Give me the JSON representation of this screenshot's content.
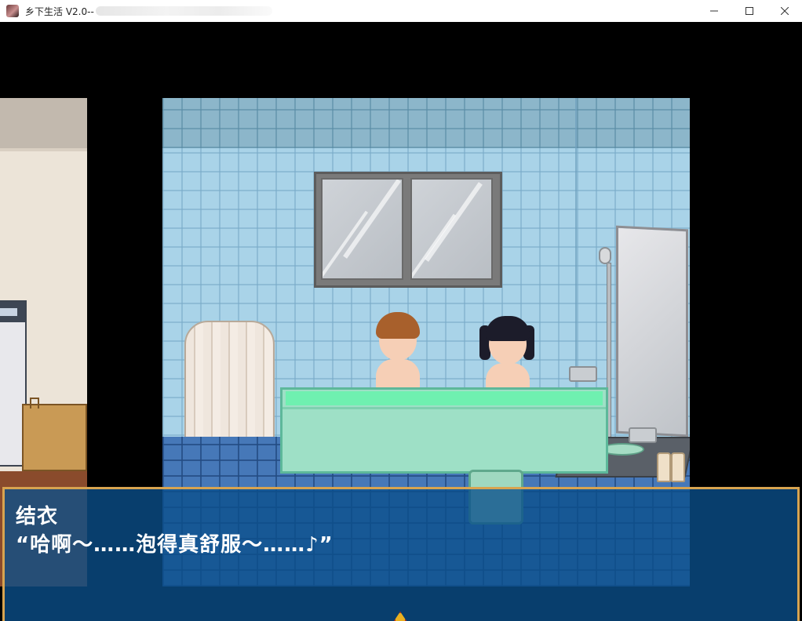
{
  "window": {
    "title": "乡下生活 V2.0--",
    "controls": [
      "minimize-icon",
      "maximize-icon",
      "close-icon"
    ]
  },
  "dialogue": {
    "speaker": "结衣",
    "text": "“哈啊～……泡得真舒服～……♪”"
  },
  "colors": {
    "dialogue_bg": "#0a508c",
    "dialogue_border": "#d8a450",
    "wall_tile": "#a9d3e8",
    "floor_tile": "#4678b8",
    "bath_water": "#6ff0b0"
  }
}
